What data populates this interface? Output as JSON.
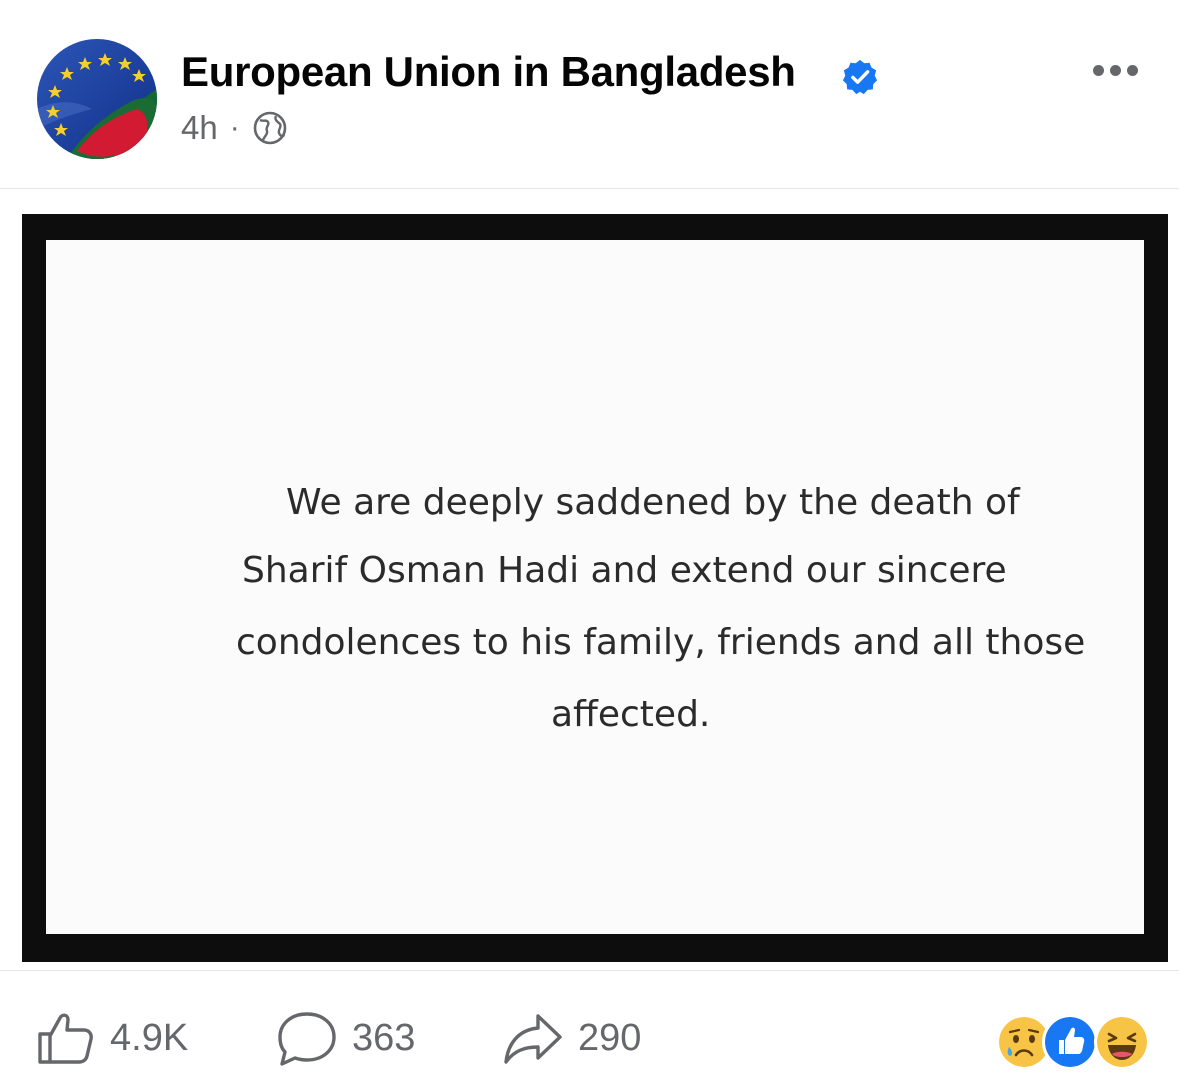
{
  "post": {
    "page_name": "European Union in Bangladesh",
    "time": "4h",
    "meta_separator": "·",
    "verified": true,
    "audience_icon": "globe-icon",
    "avatar_icon": "eu-bangladesh-flag-avatar"
  },
  "image": {
    "lines": [
      "We are deeply saddened by the death of",
      "Sharif Osman Hadi and extend our sincere",
      "condolences to his family, friends and all those",
      "affected."
    ]
  },
  "footer": {
    "likes": "4.9K",
    "comments": "363",
    "shares": "290",
    "reactions": [
      "sad-reaction-icon",
      "like-reaction-icon",
      "haha-reaction-icon"
    ]
  },
  "colors": {
    "verified_blue": "#1877f2",
    "secondary_text": "#65676b",
    "frame": "#0d0d0d"
  }
}
